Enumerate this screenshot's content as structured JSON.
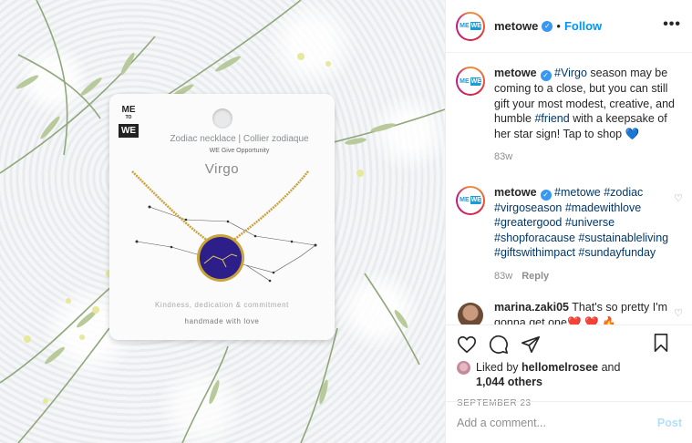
{
  "photo": {
    "card": {
      "logo_top": "ME",
      "logo_mid": "TO",
      "logo_bottom": "WE",
      "subtitle": "Zodiac necklace | Collier zodiaque",
      "brand": "WE Give Opportunity",
      "sign": "Virgo",
      "tagline": "Kindness, dedication & commitment",
      "handmade": "handmade with love"
    }
  },
  "header": {
    "username": "metowe",
    "follow_label": "Follow",
    "more_label": "•••"
  },
  "caption": {
    "username": "metowe",
    "parts": [
      "#Virgo",
      " season may be coming to a close, but you can still gift your most modest, creative, and humble ",
      "#friend",
      " with a keepsake of her star sign! Tap to shop 💙"
    ],
    "age": "83w"
  },
  "comments": [
    {
      "username": "metowe",
      "text": "#metowe #zodiac #virgoseason #madewithlove #greatergood #universe #shopforacause #sustainableliving #giftswithimpact #sundayfunday",
      "age": "83w",
      "reply_label": "Reply"
    },
    {
      "username": "marina.zaki05",
      "text": "That's so pretty I'm gonna get one",
      "emoji": "❤️ ❤️ 🔥"
    }
  ],
  "likes": {
    "prefix": "Liked by",
    "user": "hellomelrosee",
    "and": "and",
    "others": "1,044 others"
  },
  "date": "SEPTEMBER 23",
  "add_comment": {
    "placeholder": "Add a comment...",
    "post_label": "Post"
  },
  "colors": {
    "link": "#00376b",
    "follow": "#0095f6",
    "verified": "#3897f0",
    "pendant": "#2d1f8a",
    "gold": "#c9a23a"
  }
}
